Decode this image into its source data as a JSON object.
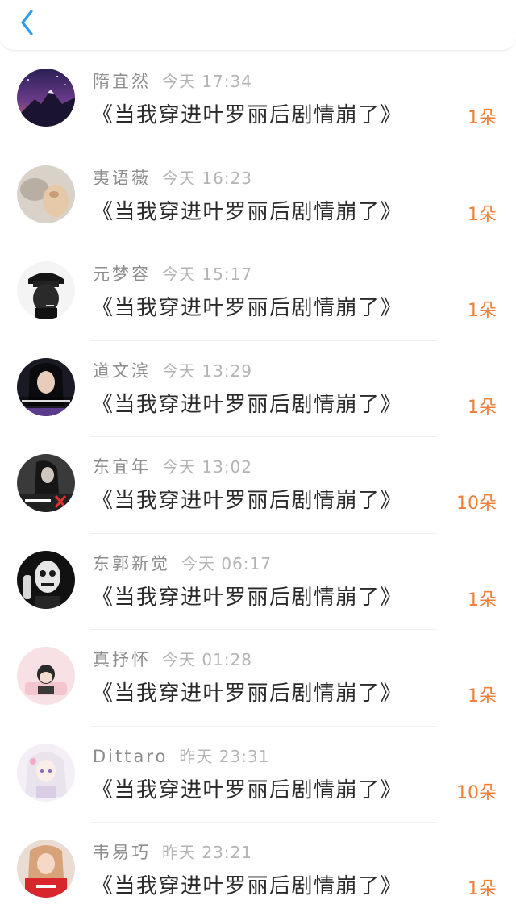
{
  "colors": {
    "accent_blue": "#2a9af3",
    "count_orange": "#ef7e36",
    "name_gray": "#8d8d8d",
    "time_gray": "#b4b4b4",
    "title_dark": "#2a2a2a"
  },
  "header": {
    "back_icon": "chevron-left-icon"
  },
  "items": [
    {
      "name": "隋宜然",
      "time": "今天 17:34",
      "title": "《当我穿进叶罗丽后剧情崩了》",
      "count": "1朵"
    },
    {
      "name": "夷语薇",
      "time": "今天 16:23",
      "title": "《当我穿进叶罗丽后剧情崩了》",
      "count": "1朵"
    },
    {
      "name": "元梦容",
      "time": "今天 15:17",
      "title": "《当我穿进叶罗丽后剧情崩了》",
      "count": "1朵"
    },
    {
      "name": "道文滨",
      "time": "今天 13:29",
      "title": "《当我穿进叶罗丽后剧情崩了》",
      "count": "1朵"
    },
    {
      "name": "东宜年",
      "time": "今天 13:02",
      "title": "《当我穿进叶罗丽后剧情崩了》",
      "count": "10朵"
    },
    {
      "name": "东郭新觉",
      "time": "今天 06:17",
      "title": "《当我穿进叶罗丽后剧情崩了》",
      "count": "1朵"
    },
    {
      "name": "真抒怀",
      "time": "今天 01:28",
      "title": "《当我穿进叶罗丽后剧情崩了》",
      "count": "1朵"
    },
    {
      "name": "Dittaro",
      "time": "昨天 23:31",
      "title": "《当我穿进叶罗丽后剧情崩了》",
      "count": "10朵"
    },
    {
      "name": "韦易巧",
      "time": "昨天 23:21",
      "title": "《当我穿进叶罗丽后剧情崩了》",
      "count": "1朵"
    }
  ]
}
